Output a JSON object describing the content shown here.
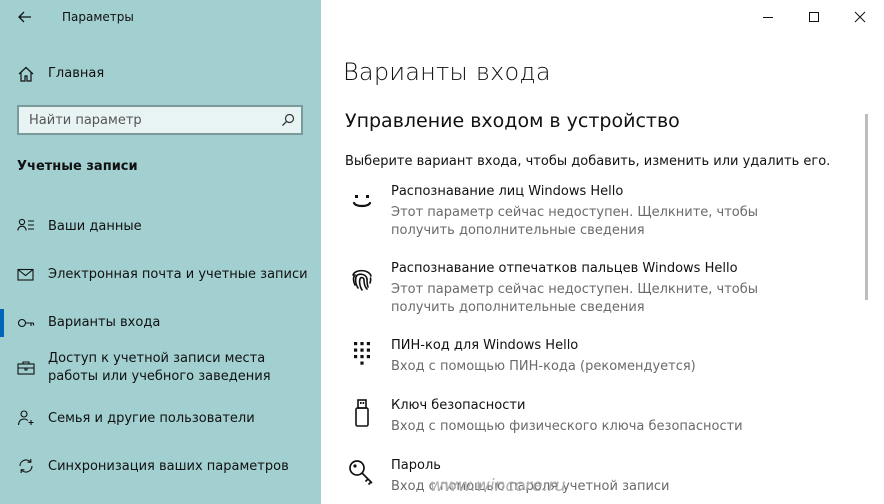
{
  "window": {
    "title": "Параметры",
    "minimize_glyph": "–",
    "maximize_glyph": "□",
    "close_glyph": "✕"
  },
  "sidebar": {
    "home_label": "Главная",
    "search_placeholder": "Найти параметр",
    "section_title": "Учетные записи",
    "items": [
      {
        "label": "Ваши данные",
        "icon": "person-lines-icon"
      },
      {
        "label": "Электронная почта и учетные записи",
        "icon": "envelope-icon"
      },
      {
        "label": "Варианты входа",
        "icon": "key-icon",
        "selected": true
      },
      {
        "label": "Доступ к учетной записи места работы или учебного заведения",
        "icon": "briefcase-icon"
      },
      {
        "label": "Семья и другие пользователи",
        "icon": "person-add-icon"
      },
      {
        "label": "Синхронизация ваших параметров",
        "icon": "sync-icon"
      }
    ]
  },
  "main": {
    "page_title": "Варианты входа",
    "subtitle": "Управление входом в устройство",
    "description": "Выберите вариант входа, чтобы добавить, изменить или удалить его.",
    "options": [
      {
        "title": "Распознавание лиц Windows Hello",
        "desc": "Этот параметр сейчас недоступен. Щелкните, чтобы получить дополнительные сведения",
        "icon": "face-icon"
      },
      {
        "title": "Распознавание отпечатков пальцев Windows Hello",
        "desc": "Этот параметр сейчас недоступен. Щелкните, чтобы получить дополнительные сведения",
        "icon": "fingerprint-icon"
      },
      {
        "title": "ПИН-код для Windows Hello",
        "desc": "Вход с помощью ПИН-кода (рекомендуется)",
        "icon": "pin-keypad-icon"
      },
      {
        "title": "Ключ безопасности",
        "desc": "Вход с помощью физического ключа безопасности",
        "icon": "usb-key-icon"
      },
      {
        "title": "Пароль",
        "desc": "Вход с помощью пароля учетной записи",
        "icon": "password-key-icon"
      }
    ]
  },
  "watermark": "www.wincore.ru",
  "colors": {
    "sidebar_bg": "#a2cfd0",
    "accent": "#0067b8",
    "main_bg": "#ffffff",
    "desc_gray": "#6a6a6a"
  }
}
